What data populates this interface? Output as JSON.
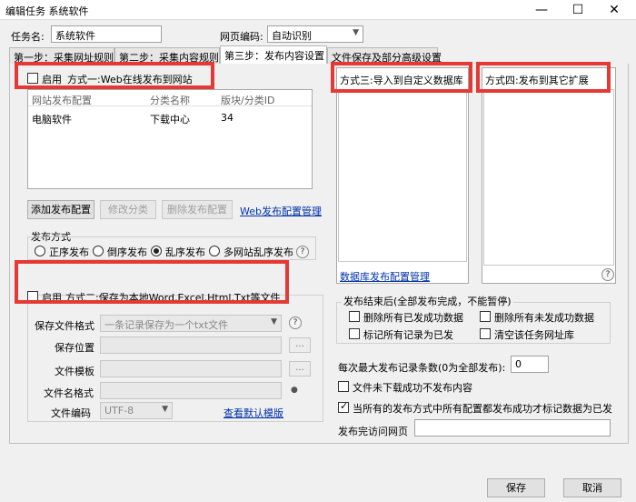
{
  "window": {
    "title": "编辑任务 系统软件",
    "minimize_glyph": "—",
    "maximize_glyph": "☐",
    "close_glyph": "✕"
  },
  "top": {
    "task_name_label": "任务名:",
    "task_name_value": "系统软件",
    "encoding_label": "网页编码:",
    "encoding_value": "自动识别"
  },
  "tabs": [
    {
      "label": "第一步：采集网址规则"
    },
    {
      "label": "第二步：采集内容规则"
    },
    {
      "label": "第三步：发布内容设置"
    },
    {
      "label": "文件保存及部分高级设置"
    }
  ],
  "method1": {
    "enable_label": "启用",
    "title": "方式一:Web在线发布到网站",
    "table_headers": [
      "网站发布配置",
      "分类名称",
      "版块/分类ID"
    ],
    "rows": [
      [
        "电脑软件",
        "下载中心",
        "34"
      ]
    ],
    "add_button": "添加发布配置",
    "edit_button": "修改分类",
    "delete_button": "删除发布配置",
    "manage_link": "Web发布配置管理",
    "order_group_label": "发布方式",
    "order_options": [
      "正序发布",
      "倒序发布",
      "乱序发布",
      "多网站乱序发布"
    ],
    "order_selected_index": 2
  },
  "method2": {
    "enable_label": "启用",
    "title": "方式二:保存为本地Word,Excel,Html,Txt等文件",
    "format_label": "保存文件格式",
    "format_value": "一条记录保存为一个txt文件",
    "location_label": "保存位置",
    "template_label": "文件模板",
    "filename_label": "文件名格式",
    "encoding_label": "文件编码",
    "encoding_value": "UTF-8",
    "default_template_link": "查看默认模版",
    "browse_glyph": "...",
    "help_glyph": "?",
    "pin_glyph": "●"
  },
  "method3": {
    "title": "方式三:导入到自定义数据库",
    "manage_link": "数据库发布配置管理"
  },
  "method4": {
    "title": "方式四:发布到其它扩展"
  },
  "after_publish": {
    "group_label": "发布结束后(全部发布完成，不能暂停)",
    "options": [
      {
        "label": "删除所有已发成功数据",
        "checked": false
      },
      {
        "label": "删除所有未发成功数据",
        "checked": false
      },
      {
        "label": "标记所有记录为已发",
        "checked": false
      },
      {
        "label": "清空该任务网址库",
        "checked": false
      }
    ],
    "max_count_label": "每次最大发布记录条数(0为全部发布):",
    "max_count_value": "0",
    "skip_failed_download_label": "文件未下载成功不发布内容",
    "skip_failed_download_checked": false,
    "mark_when_all_success_label": "当所有的发布方式中所有配置都发布成功才标记数据为已发",
    "mark_when_all_success_checked": true,
    "visit_url_label": "发布完访问网页",
    "visit_url_value": ""
  },
  "footer": {
    "save_button": "保存",
    "cancel_button": "取消"
  },
  "colors": {
    "highlight_box": "#e53935",
    "link": "#0033aa"
  }
}
